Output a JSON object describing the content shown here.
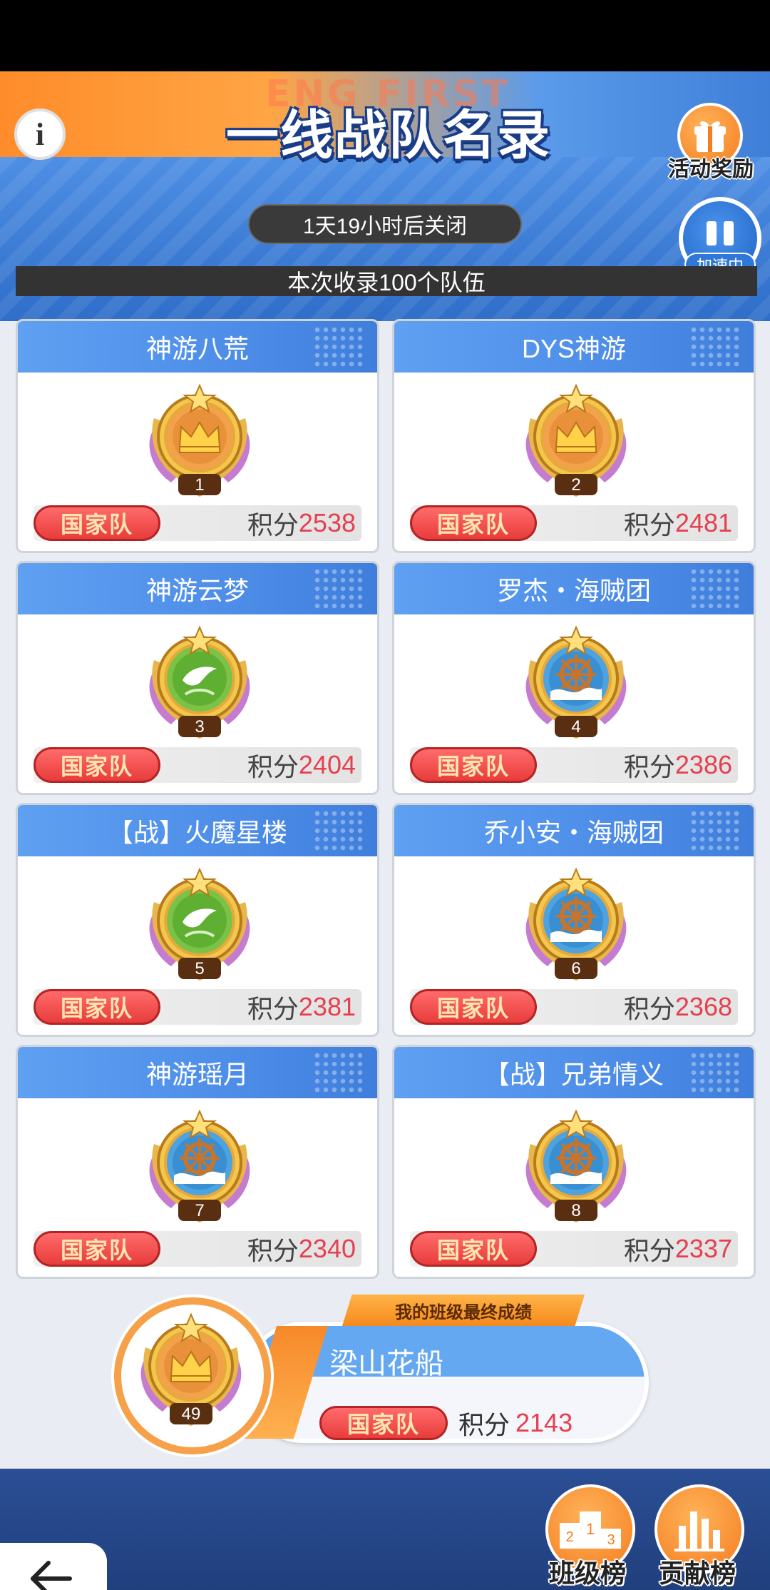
{
  "header": {
    "ghost_title": "ENG FIRST",
    "title": "一线战队名录",
    "reward_label": "活动奖励",
    "timer": "1天19小时后关闭",
    "speed_label": "加速中",
    "banner": "本次收录100个队伍"
  },
  "teams": [
    {
      "name": "神游八荒",
      "rank": "1",
      "tag": "国家队",
      "score_label": "积分",
      "score": "2538",
      "emblem": "crown"
    },
    {
      "name": "DYS神游",
      "rank": "2",
      "tag": "国家队",
      "score_label": "积分",
      "score": "2481",
      "emblem": "crown"
    },
    {
      "name": "神游云梦",
      "rank": "3",
      "tag": "国家队",
      "score_label": "积分",
      "score": "2404",
      "emblem": "dove"
    },
    {
      "name": "罗杰・海贼团",
      "rank": "4",
      "tag": "国家队",
      "score_label": "积分",
      "score": "2386",
      "emblem": "helm"
    },
    {
      "name": "【战】火魔星楼",
      "rank": "5",
      "tag": "国家队",
      "score_label": "积分",
      "score": "2381",
      "emblem": "dove"
    },
    {
      "name": "乔小安・海贼团",
      "rank": "6",
      "tag": "国家队",
      "score_label": "积分",
      "score": "2368",
      "emblem": "helm"
    },
    {
      "name": "神游瑶月",
      "rank": "7",
      "tag": "国家队",
      "score_label": "积分",
      "score": "2340",
      "emblem": "helm"
    },
    {
      "name": "【战】兄弟情义",
      "rank": "8",
      "tag": "国家队",
      "score_label": "积分",
      "score": "2337",
      "emblem": "helm"
    }
  ],
  "my_team": {
    "ribbon": "我的班级最终成绩",
    "name": "梁山花船",
    "rank": "49",
    "tag": "国家队",
    "score_label": "积分",
    "score": "2143",
    "emblem": "crown"
  },
  "footer": {
    "back_label": "返回",
    "class_rank_label": "班级榜",
    "contribution_label": "贡献榜"
  },
  "colors": {
    "accent_orange": "#f57c1f",
    "header_blue": "#4a8ae6",
    "score_red": "#e5404f",
    "tag_red": "#e83c3c"
  }
}
